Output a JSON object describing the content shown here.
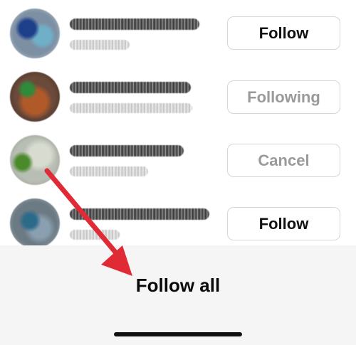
{
  "suggestions": [
    {
      "button_label": "Follow",
      "state": "follow"
    },
    {
      "button_label": "Following",
      "state": "following"
    },
    {
      "button_label": "Cancel",
      "state": "requested"
    },
    {
      "button_label": "Follow",
      "state": "follow"
    }
  ],
  "sheet": {
    "follow_all_label": "Follow all"
  },
  "colors": {
    "arrow": "#e02a36",
    "muted_text": "#9a9a9a"
  }
}
